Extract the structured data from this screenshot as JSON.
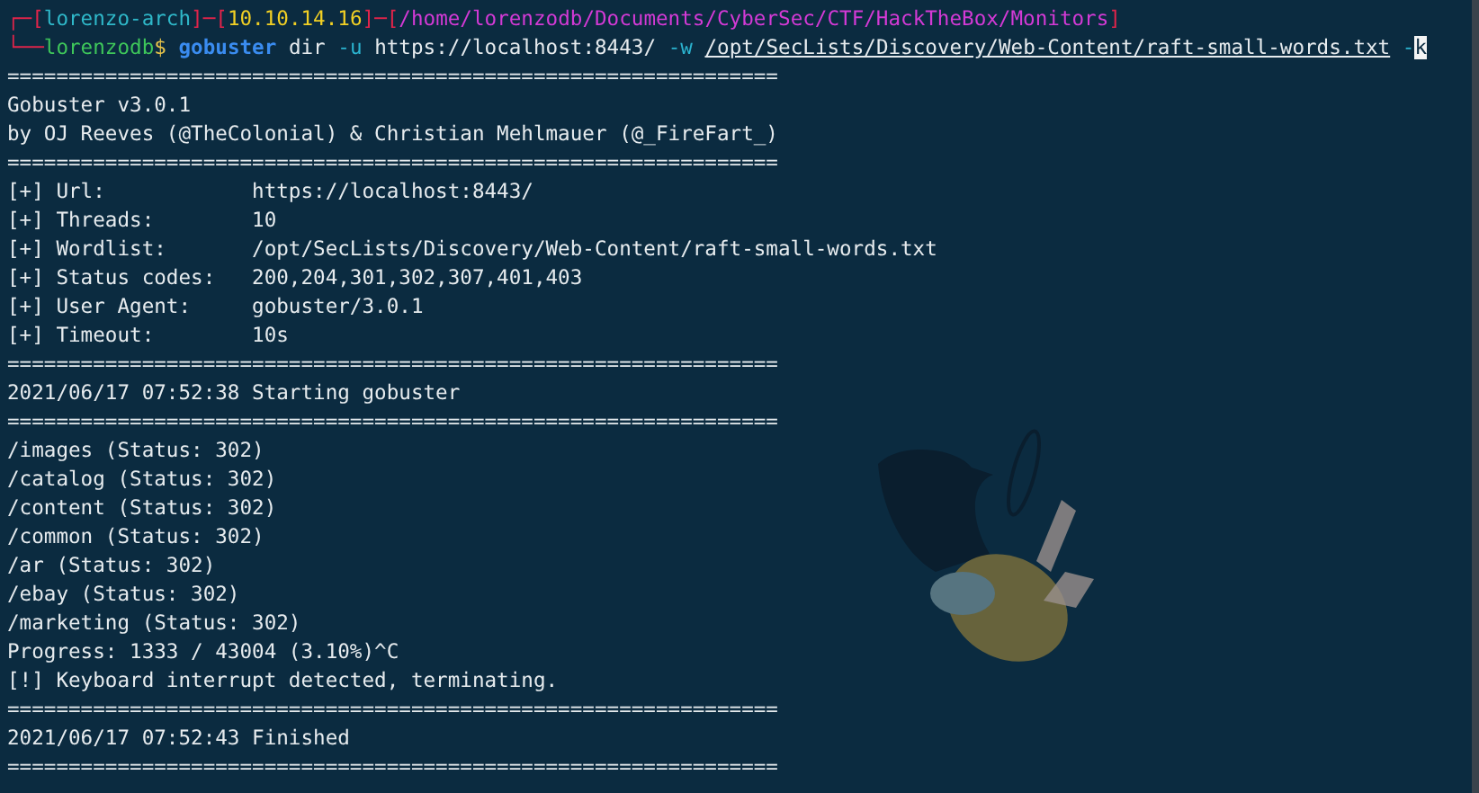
{
  "terminal": {
    "lines": [
      [
        {
          "kind": "bracket",
          "text": "┌─["
        },
        {
          "kind": "host",
          "text": "lorenzo-arch"
        },
        {
          "kind": "bracket",
          "text": "]─["
        },
        {
          "kind": "ip",
          "text": "10.10.14.16"
        },
        {
          "kind": "bracket",
          "text": "]─["
        },
        {
          "kind": "path",
          "text": "/home/lorenzodb/Documents/CyberSec/CTF/HackTheBox/Monitors"
        },
        {
          "kind": "bracket",
          "text": "]"
        }
      ],
      [
        {
          "kind": "bracket",
          "text": "└──"
        },
        {
          "kind": "user",
          "text": "lorenzodb"
        },
        {
          "kind": "dollar",
          "text": "$"
        },
        {
          "kind": "command",
          "text": " gobuster"
        },
        {
          "kind": "plain",
          "text": " dir "
        },
        {
          "kind": "flag",
          "text": "-u"
        },
        {
          "kind": "plain",
          "text": " https://localhost:8443/ "
        },
        {
          "kind": "flag",
          "text": "-w "
        },
        {
          "kind": "file",
          "text": "/opt/SecLists/Discovery/Web-Content/raft-small-words.txt"
        },
        {
          "kind": "flag",
          "text": " -"
        },
        {
          "kind": "cursor",
          "text": "k"
        }
      ],
      [
        {
          "kind": "plain",
          "text": "==============================================================="
        }
      ],
      [
        {
          "kind": "plain",
          "text": "Gobuster v3.0.1"
        }
      ],
      [
        {
          "kind": "plain",
          "text": "by OJ Reeves (@TheColonial) & Christian Mehlmauer (@_FireFart_)"
        }
      ],
      [
        {
          "kind": "plain",
          "text": "==============================================================="
        }
      ],
      [
        {
          "kind": "plain",
          "text": "[+] Url:            https://localhost:8443/"
        }
      ],
      [
        {
          "kind": "plain",
          "text": "[+] Threads:        10"
        }
      ],
      [
        {
          "kind": "plain",
          "text": "[+] Wordlist:       /opt/SecLists/Discovery/Web-Content/raft-small-words.txt"
        }
      ],
      [
        {
          "kind": "plain",
          "text": "[+] Status codes:   200,204,301,302,307,401,403"
        }
      ],
      [
        {
          "kind": "plain",
          "text": "[+] User Agent:     gobuster/3.0.1"
        }
      ],
      [
        {
          "kind": "plain",
          "text": "[+] Timeout:        10s"
        }
      ],
      [
        {
          "kind": "plain",
          "text": "==============================================================="
        }
      ],
      [
        {
          "kind": "plain",
          "text": "2021/06/17 07:52:38 Starting gobuster"
        }
      ],
      [
        {
          "kind": "plain",
          "text": "==============================================================="
        }
      ],
      [
        {
          "kind": "plain",
          "text": "/images (Status: 302)"
        }
      ],
      [
        {
          "kind": "plain",
          "text": "/catalog (Status: 302)"
        }
      ],
      [
        {
          "kind": "plain",
          "text": "/content (Status: 302)"
        }
      ],
      [
        {
          "kind": "plain",
          "text": "/common (Status: 302)"
        }
      ],
      [
        {
          "kind": "plain",
          "text": "/ar (Status: 302)"
        }
      ],
      [
        {
          "kind": "plain",
          "text": "/ebay (Status: 302)"
        }
      ],
      [
        {
          "kind": "plain",
          "text": "/marketing (Status: 302)"
        }
      ],
      [
        {
          "kind": "plain",
          "text": "Progress: 1333 / 43004 (3.10%)^C"
        }
      ],
      [
        {
          "kind": "plain",
          "text": "[!] Keyboard interrupt detected, terminating."
        }
      ],
      [
        {
          "kind": "plain",
          "text": "==============================================================="
        }
      ],
      [
        {
          "kind": "plain",
          "text": "2021/06/17 07:52:43 Finished"
        }
      ],
      [
        {
          "kind": "plain",
          "text": "==============================================================="
        }
      ]
    ]
  }
}
